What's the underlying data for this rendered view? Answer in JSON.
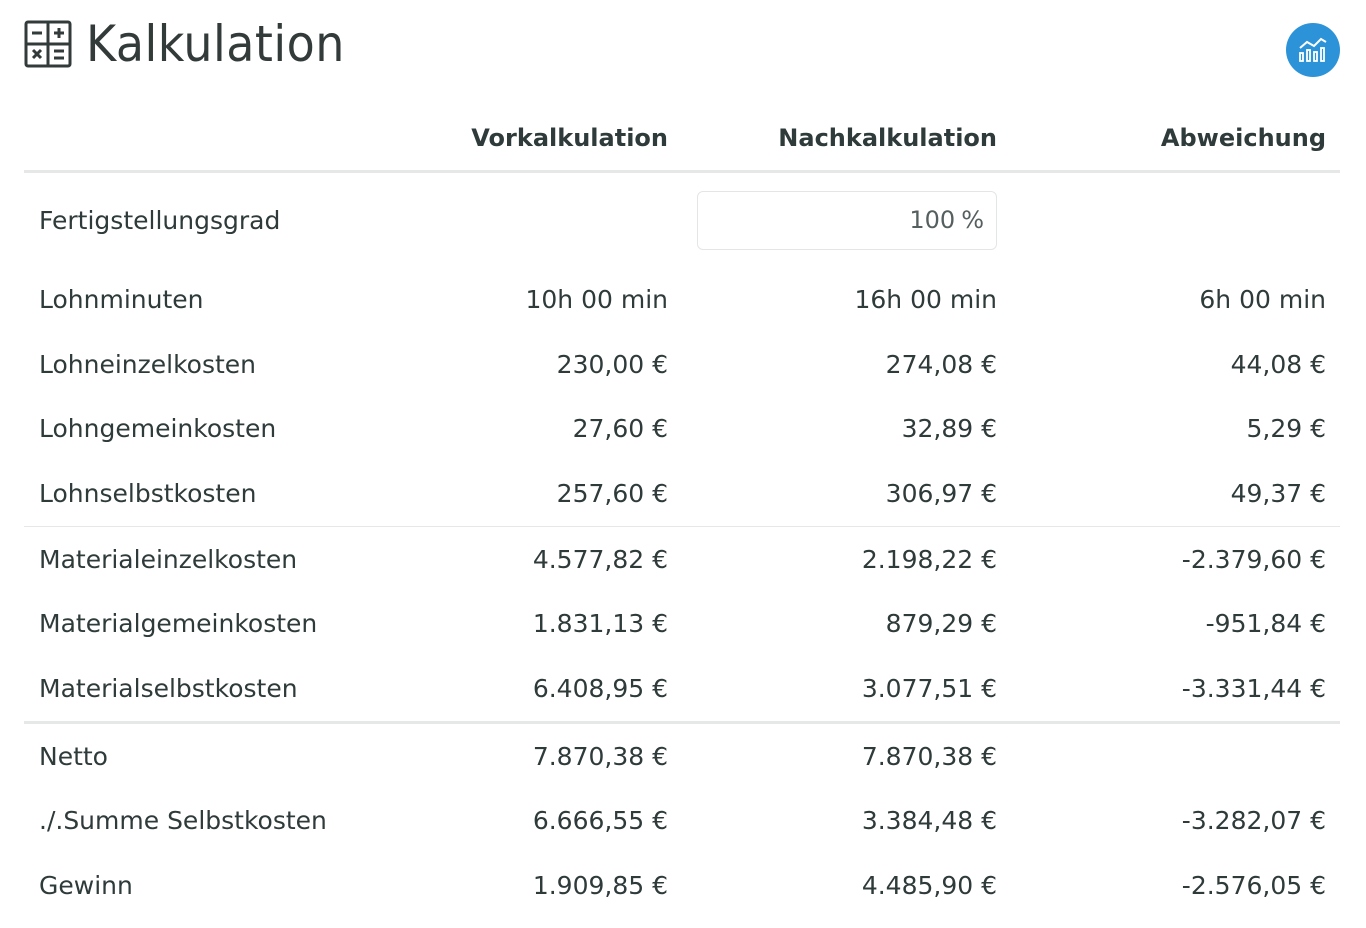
{
  "title": "Kalkulation",
  "icons": {
    "title_icon": "calculator-icon",
    "chart_button_icon": "bar-line-chart-icon",
    "accent": "#2d93d8"
  },
  "table": {
    "headers": [
      "",
      "Vorkalkulation",
      "Nachkalkulation",
      "Abweichung"
    ],
    "fertigstellungsgrad": {
      "label": "Fertigstellungsgrad",
      "value": "100",
      "unit": "%"
    },
    "rows": [
      {
        "label": "Lohnminuten",
        "vor": "10h 00 min",
        "nach": "16h 00 min",
        "abw": "6h 00 min"
      },
      {
        "label": "Lohneinzelkosten",
        "vor": "230,00 €",
        "nach": "274,08 €",
        "abw": "44,08 €"
      },
      {
        "label": "Lohngemeinkosten",
        "vor": "27,60 €",
        "nach": "32,89 €",
        "abw": "5,29 €"
      },
      {
        "label": "Lohnselbstkosten",
        "vor": "257,60 €",
        "nach": "306,97 €",
        "abw": "49,37 €"
      },
      {
        "label": "Materialeinzelkosten",
        "vor": "4.577,82 €",
        "nach": "2.198,22 €",
        "abw": "-2.379,60 €"
      },
      {
        "label": "Materialgemeinkosten",
        "vor": "1.831,13 €",
        "nach": "879,29 €",
        "abw": "-951,84 €"
      },
      {
        "label": "Materialselbstkosten",
        "vor": "6.408,95 €",
        "nach": "3.077,51 €",
        "abw": "-3.331,44 €"
      },
      {
        "label": "Netto",
        "vor": "7.870,38 €",
        "nach": "7.870,38 €",
        "abw": ""
      },
      {
        "label": "./.Summe Selbstkosten",
        "vor": "6.666,55 €",
        "nach": "3.384,48 €",
        "abw": "-3.282,07 €"
      },
      {
        "label": "Gewinn",
        "vor": "1.909,85 €",
        "nach": "4.485,90 €",
        "abw": "-2.576,05 €"
      }
    ]
  }
}
